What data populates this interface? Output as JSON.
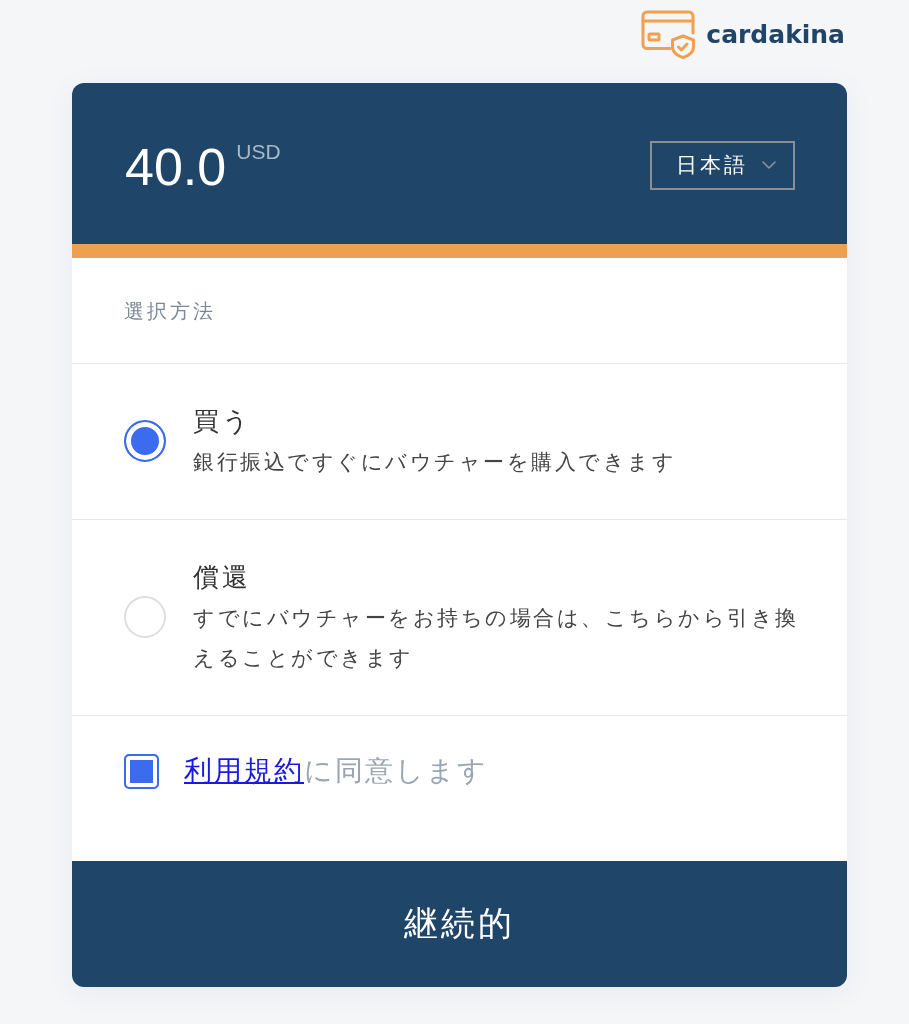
{
  "logo": {
    "text": "cardakina"
  },
  "header": {
    "amount": "40.0",
    "currency": "USD",
    "language": {
      "label": "日本語"
    }
  },
  "method": {
    "label": "選択方法",
    "options": [
      {
        "title": "買う",
        "description": "銀行振込ですぐにバウチャーを購入できます",
        "selected": true
      },
      {
        "title": "償還",
        "description": "すでにバウチャーをお持ちの場合は、こちらから引き換えることができます",
        "selected": false
      }
    ]
  },
  "terms": {
    "checked": true,
    "link": "利用規約",
    "text": "に同意します"
  },
  "continue_button": {
    "label": "継続的"
  }
}
